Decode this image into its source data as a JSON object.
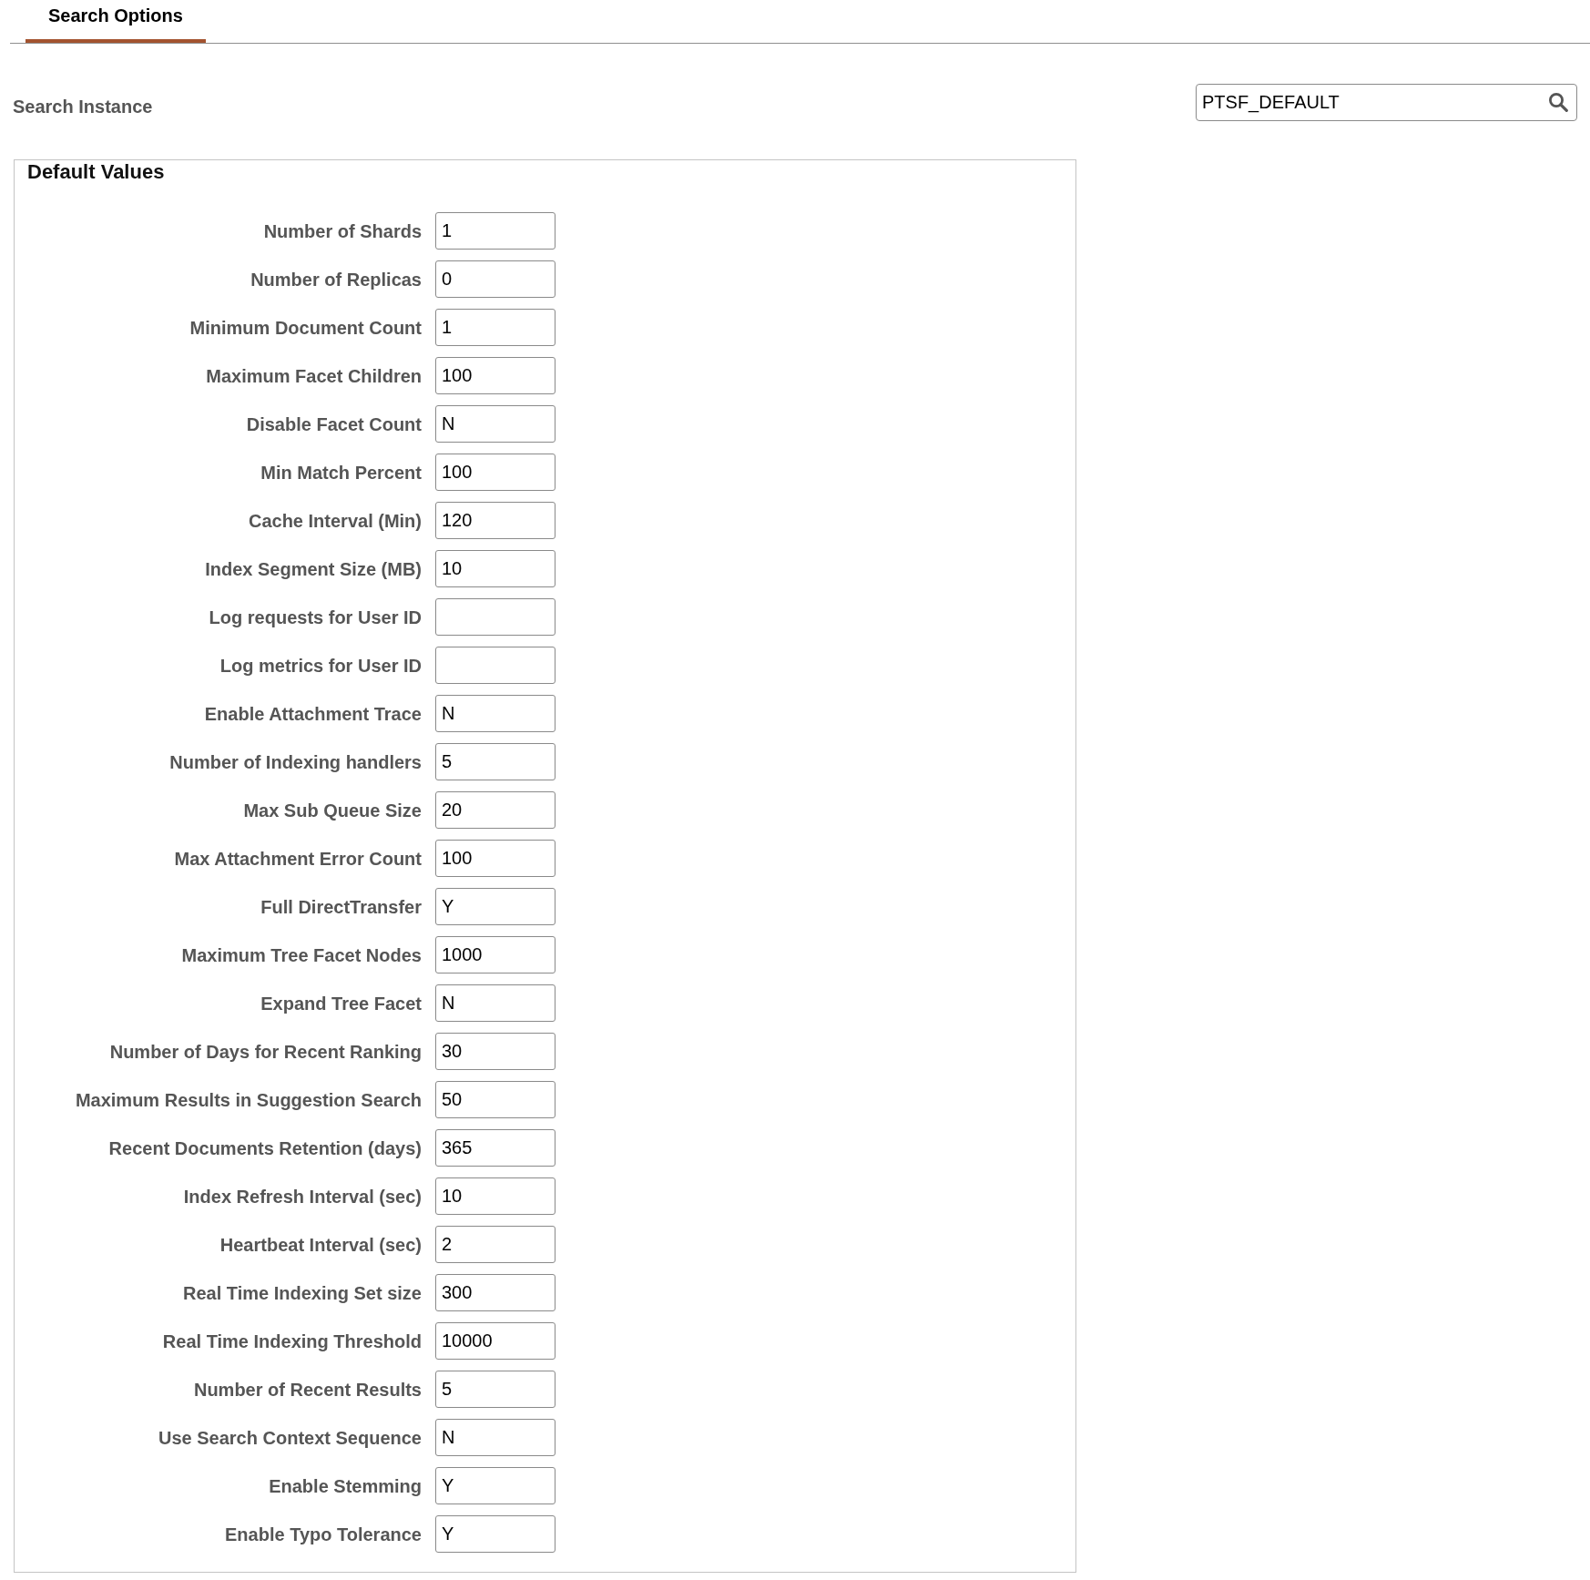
{
  "tabs": [
    {
      "label": "Search Options",
      "selected": true
    }
  ],
  "search_instance": {
    "label": "Search Instance",
    "value": "PTSF_DEFAULT"
  },
  "default_values": {
    "title": "Default Values",
    "fields": [
      {
        "label": "Number of Shards",
        "value": "1"
      },
      {
        "label": "Number of Replicas",
        "value": "0"
      },
      {
        "label": "Minimum Document Count",
        "value": "1"
      },
      {
        "label": "Maximum Facet Children",
        "value": "100"
      },
      {
        "label": "Disable Facet Count",
        "value": "N"
      },
      {
        "label": "Min Match Percent",
        "value": "100"
      },
      {
        "label": "Cache Interval (Min)",
        "value": "120"
      },
      {
        "label": "Index Segment Size (MB)",
        "value": "10"
      },
      {
        "label": "Log requests for User ID"
      },
      {
        "label": "Log metrics for User ID"
      },
      {
        "label": "Enable Attachment Trace",
        "value": "N"
      },
      {
        "label": "Number of Indexing handlers",
        "value": "5"
      },
      {
        "label": "Max Sub Queue Size",
        "value": "20"
      },
      {
        "label": "Max Attachment Error Count",
        "value": "100"
      },
      {
        "label": "Full DirectTransfer",
        "value": "Y"
      },
      {
        "label": "Maximum Tree Facet Nodes",
        "value": "1000"
      },
      {
        "label": "Expand Tree Facet",
        "value": "N"
      },
      {
        "label": "Number of Days for Recent Ranking",
        "value": "30"
      },
      {
        "label": "Maximum Results in Suggestion Search",
        "value": "50"
      },
      {
        "label": "Recent Documents Retention (days)",
        "value": "365"
      },
      {
        "label": "Index Refresh Interval (sec)",
        "value": "10"
      },
      {
        "label": "Heartbeat Interval (sec)",
        "value": "2"
      },
      {
        "label": "Real Time Indexing Set size",
        "value": "300"
      },
      {
        "label": "Real Time Indexing Threshold",
        "value": "10000"
      },
      {
        "label": "Number of Recent Results",
        "value": "5"
      },
      {
        "label": "Use Search Context Sequence",
        "value": "N"
      },
      {
        "label": "Enable Stemming",
        "value": "Y"
      },
      {
        "label": "Enable Typo Tolerance",
        "value": "Y"
      }
    ]
  }
}
